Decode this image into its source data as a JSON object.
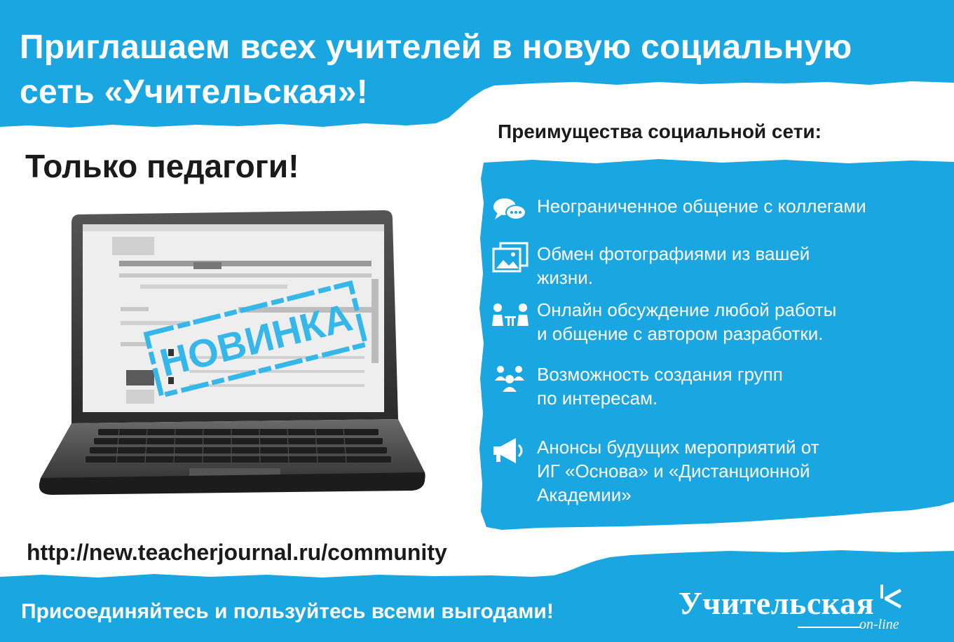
{
  "colors": {
    "accent_blue": "#1aa6e0",
    "text_dark": "#1a1a1a",
    "white": "#ffffff"
  },
  "header": {
    "headline_line1": "Приглашаем всех учителей в новую социальную",
    "headline_line2": "сеть «Учительская»!"
  },
  "left": {
    "subheading": "Только педагоги!",
    "laptop_stamp": "НОВИНКА"
  },
  "benefits": {
    "title": "Преимущества социальной сети:",
    "items": [
      {
        "icon": "chat-bubbles-icon",
        "line1": "Неограниченное общение с коллегами",
        "line2": ""
      },
      {
        "icon": "photos-icon",
        "line1": "Обмен фотографиями из вашей",
        "line2": "жизни."
      },
      {
        "icon": "discussion-people-icon",
        "line1": "Онлайн обсуждение любой работы",
        "line2": "и общение с автором разработки."
      },
      {
        "icon": "group-people-icon",
        "line1": "Возможность создания групп",
        "line2": "по интересам."
      },
      {
        "icon": "megaphone-icon",
        "line1": "Анонсы будущих мероприятий от",
        "line2": "ИГ «Основа» и «Дистанционной",
        "line3": "Академии»"
      }
    ]
  },
  "url": "http://new.teacherjournal.ru/community",
  "footer": {
    "cta": "Присоединяйтесь и пользуйтесь всеми выгодами!",
    "logo_text": "Учительская",
    "logo_sub": "on-line"
  }
}
